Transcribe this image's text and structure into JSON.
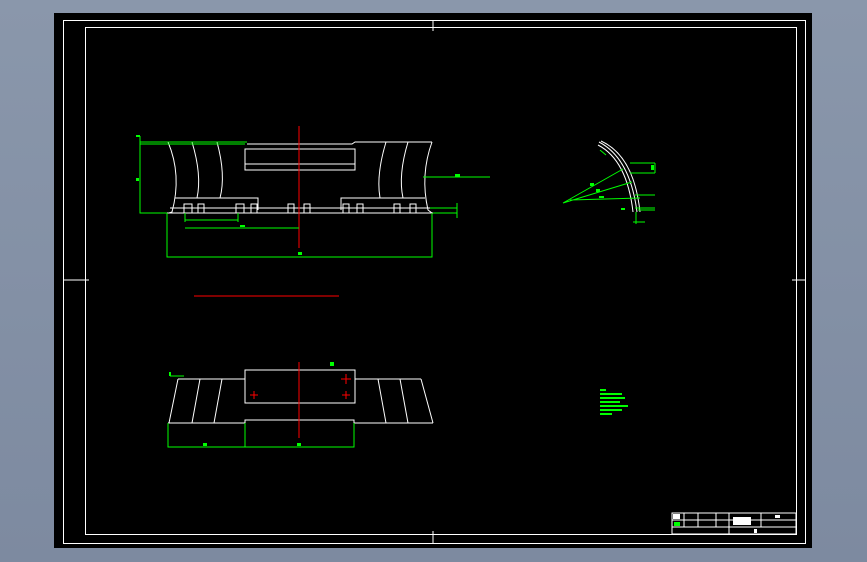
{
  "drawing": {
    "background_color": "#000000",
    "line_color": "#ffffff",
    "dimension_color": "#00ff00",
    "centerline_color": "#ff0000",
    "viewport_frame_color": "#8a97ab"
  }
}
